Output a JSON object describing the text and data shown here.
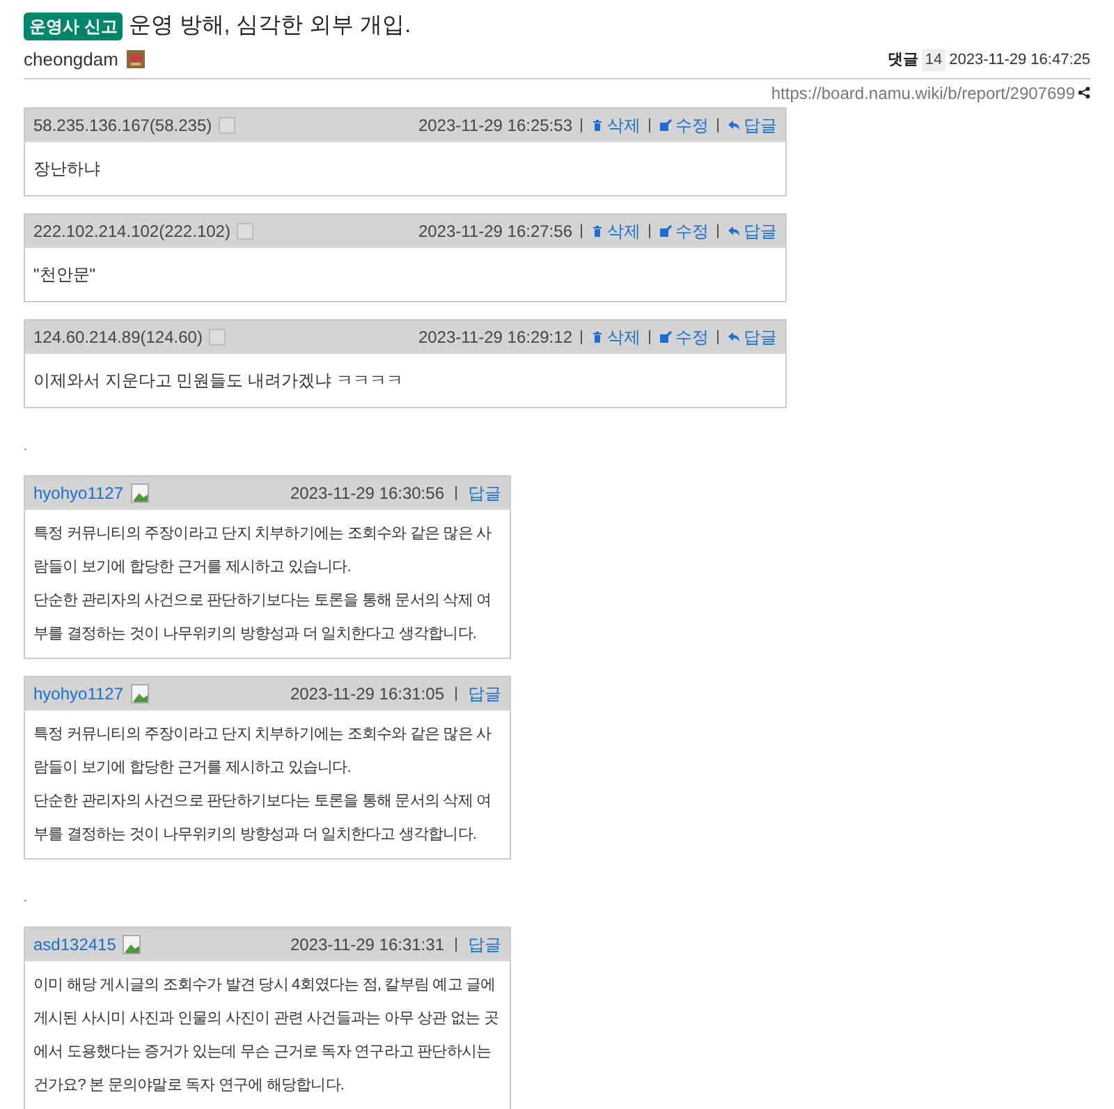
{
  "post": {
    "badge": "운영사 신고",
    "title": "운영 방해, 심각한 외부 개입.",
    "author": "cheongdam",
    "comment_label": "댓글",
    "comment_count": "14",
    "date": "2023-11-29 16:47:25",
    "url": "https://board.namu.wiki/b/report/2907699"
  },
  "entries": [
    {
      "kind": "anon",
      "user": "58.235.136.167(58.235)",
      "date": "2023-11-29 16:25:53",
      "actions": [
        {
          "kind": "delete",
          "label": "삭제"
        },
        {
          "kind": "edit",
          "label": "수정"
        },
        {
          "kind": "reply",
          "label": "답글"
        }
      ],
      "body": [
        "장난하냐"
      ]
    },
    {
      "kind": "anon",
      "user": "222.102.214.102(222.102)",
      "date": "2023-11-29 16:27:56",
      "actions": [
        {
          "kind": "delete",
          "label": "삭제"
        },
        {
          "kind": "edit",
          "label": "수정"
        },
        {
          "kind": "reply",
          "label": "답글"
        }
      ],
      "body": [
        "\"천안문\""
      ]
    },
    {
      "kind": "anon",
      "user": "124.60.214.89(124.60)",
      "date": "2023-11-29 16:29:12",
      "actions": [
        {
          "kind": "delete",
          "label": "삭제"
        },
        {
          "kind": "edit",
          "label": "수정"
        },
        {
          "kind": "reply",
          "label": "답글"
        }
      ],
      "body": [
        "이제와서 지운다고 민원들도 내려가겠냐 ㅋㅋㅋㅋ"
      ]
    },
    {
      "kind": "separator",
      "text": "."
    },
    {
      "kind": "member",
      "user": "hyohyo1127",
      "date": "2023-11-29 16:30:56",
      "actions": [
        {
          "kind": "reply",
          "label": "답글"
        }
      ],
      "body": [
        "특정 커뮤니티의 주장이라고 단지 치부하기에는 조회수와 같은 많은 사람들이 보기에 합당한 근거를 제시하고 있습니다.",
        "단순한 관리자의 사건으로 판단하기보다는 토론을 통해 문서의 삭제 여부를 결정하는 것이 나무위키의 방향성과 더 일치한다고 생각합니다."
      ]
    },
    {
      "kind": "member",
      "user": "hyohyo1127",
      "date": "2023-11-29 16:31:05",
      "actions": [
        {
          "kind": "reply",
          "label": "답글"
        }
      ],
      "body": [
        "특정 커뮤니티의 주장이라고 단지 치부하기에는 조회수와 같은 많은 사람들이 보기에 합당한 근거를 제시하고 있습니다.",
        "단순한 관리자의 사건으로 판단하기보다는 토론을 통해 문서의 삭제 여부를 결정하는 것이 나무위키의 방향성과 더 일치한다고 생각합니다."
      ]
    },
    {
      "kind": "separator",
      "text": "."
    },
    {
      "kind": "member",
      "user": "asd132415",
      "date": "2023-11-29 16:31:31",
      "actions": [
        {
          "kind": "reply",
          "label": "답글"
        }
      ],
      "body": [
        "이미 해당 게시글의 조회수가 발견 당시 4회였다는 점, 칼부림 예고 글에 게시된 사시미 사진과 인물의 사진이 관련 사건들과는 아무 상관 없는 곳에서 도용했다는 증거가 있는데 무슨 근거로 독자 연구라고 판단하시는 건가요? 본 문의야말로 독자 연구에 해당합니다."
      ]
    }
  ]
}
